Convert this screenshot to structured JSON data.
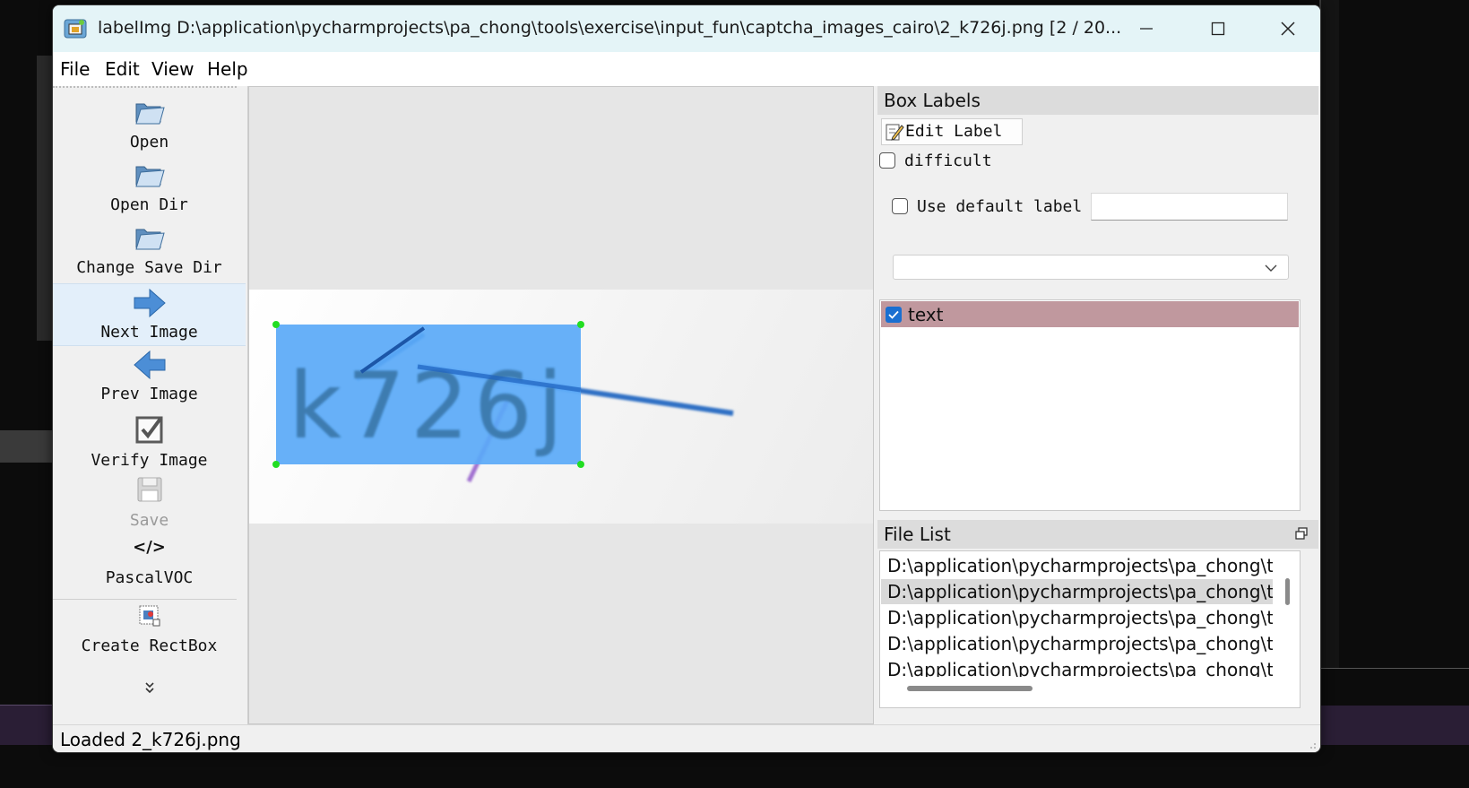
{
  "window": {
    "title": "labelImg D:\\application\\pycharmprojects\\pa_chong\\tools\\exercise\\input_fun\\captcha_images_cairo\\2_k726j.png [2 / 20..."
  },
  "menu": [
    "File",
    "Edit",
    "View",
    "Help"
  ],
  "toolbar": {
    "open": "Open",
    "open_dir": "Open Dir",
    "change_save_dir": "Change Save Dir",
    "next_image": "Next Image",
    "prev_image": "Prev Image",
    "verify_image": "Verify Image",
    "save": "Save",
    "format_icon": "</>",
    "format": "PascalVOC",
    "create_rectbox": "Create RectBox"
  },
  "canvas": {
    "captcha_text": "k726j",
    "box_label": "text",
    "colors": {
      "box_fill": "#5aa9f7",
      "corner": "#22dd22",
      "captcha_ink": "#2d6e9e"
    }
  },
  "box_labels": {
    "title": "Box Labels",
    "edit_label": "Edit Label",
    "difficult": "difficult",
    "difficult_checked": false,
    "use_default_label": "Use default label",
    "use_default_checked": false,
    "default_label_value": "",
    "combo_value": "",
    "labels": [
      {
        "text": "text",
        "checked": true,
        "color": "#c0989e"
      }
    ]
  },
  "file_list": {
    "title": "File List",
    "items": [
      "D:\\application\\pycharmprojects\\pa_chong\\to",
      "D:\\application\\pycharmprojects\\pa_chong\\to",
      "D:\\application\\pycharmprojects\\pa_chong\\to",
      "D:\\application\\pycharmprojects\\pa_chong\\to",
      "D:\\application\\pycharmprojects\\pa_chong\\to"
    ],
    "selected_index": 1
  },
  "status": "Loaded 2_k726j.png"
}
